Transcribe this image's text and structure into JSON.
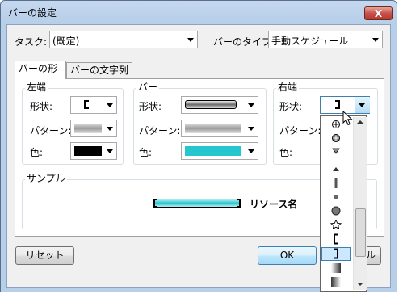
{
  "window": {
    "title": "バーの設定",
    "close_label": "X"
  },
  "task": {
    "label": "タスク:",
    "value": "(既定)"
  },
  "bar_type": {
    "label": "バーのタイプ",
    "value": "手動スケジュール"
  },
  "tabs": [
    {
      "label": "バーの形"
    },
    {
      "label": "バーの文字列"
    }
  ],
  "groups": {
    "start": {
      "title": "左端",
      "shape_label": "形状:",
      "pattern_label": "パターン:",
      "color_label": "色:",
      "color": "#000000"
    },
    "middle": {
      "title": "バー",
      "shape_label": "形状:",
      "pattern_label": "パターン:",
      "color_label": "色:",
      "color": "#26c6cf"
    },
    "end": {
      "title": "右端",
      "shape_label": "形状:",
      "pattern_label": "パターン:",
      "color_label": "色:"
    }
  },
  "sample": {
    "title": "サンプル",
    "text": "リソース名"
  },
  "buttons": {
    "reset": "リセット",
    "ok": "OK",
    "cancel": "ル"
  },
  "dropdown": {
    "items": [
      {
        "icon": "circle-plus-icon"
      },
      {
        "icon": "circle-plus-icon"
      },
      {
        "icon": "triangle-down-icon"
      },
      {
        "icon": "blank"
      },
      {
        "icon": "triangle-up-icon"
      },
      {
        "icon": "vertical-bar-icon"
      },
      {
        "icon": "square-icon"
      },
      {
        "icon": "circle-icon"
      },
      {
        "icon": "star-icon"
      },
      {
        "icon": "bracket-left-icon"
      },
      {
        "icon": "bracket-right-icon",
        "selected": true
      },
      {
        "icon": "gradient-block-icon"
      },
      {
        "icon": "gradient-block-icon"
      }
    ]
  }
}
